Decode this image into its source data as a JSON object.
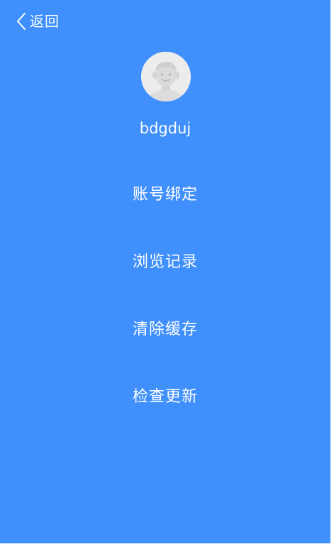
{
  "header": {
    "back_label": "返回",
    "back_icon": "chevron-left-icon"
  },
  "profile": {
    "avatar_icon": "default-avatar-icon",
    "username": "bdgduj"
  },
  "menu": {
    "items": [
      {
        "label": "账号绑定"
      },
      {
        "label": "浏览记录"
      },
      {
        "label": "清除缓存"
      },
      {
        "label": "检查更新"
      }
    ]
  },
  "colors": {
    "background": "#3f8ffd",
    "text": "#ffffff",
    "avatar_bg": "#ececec"
  }
}
